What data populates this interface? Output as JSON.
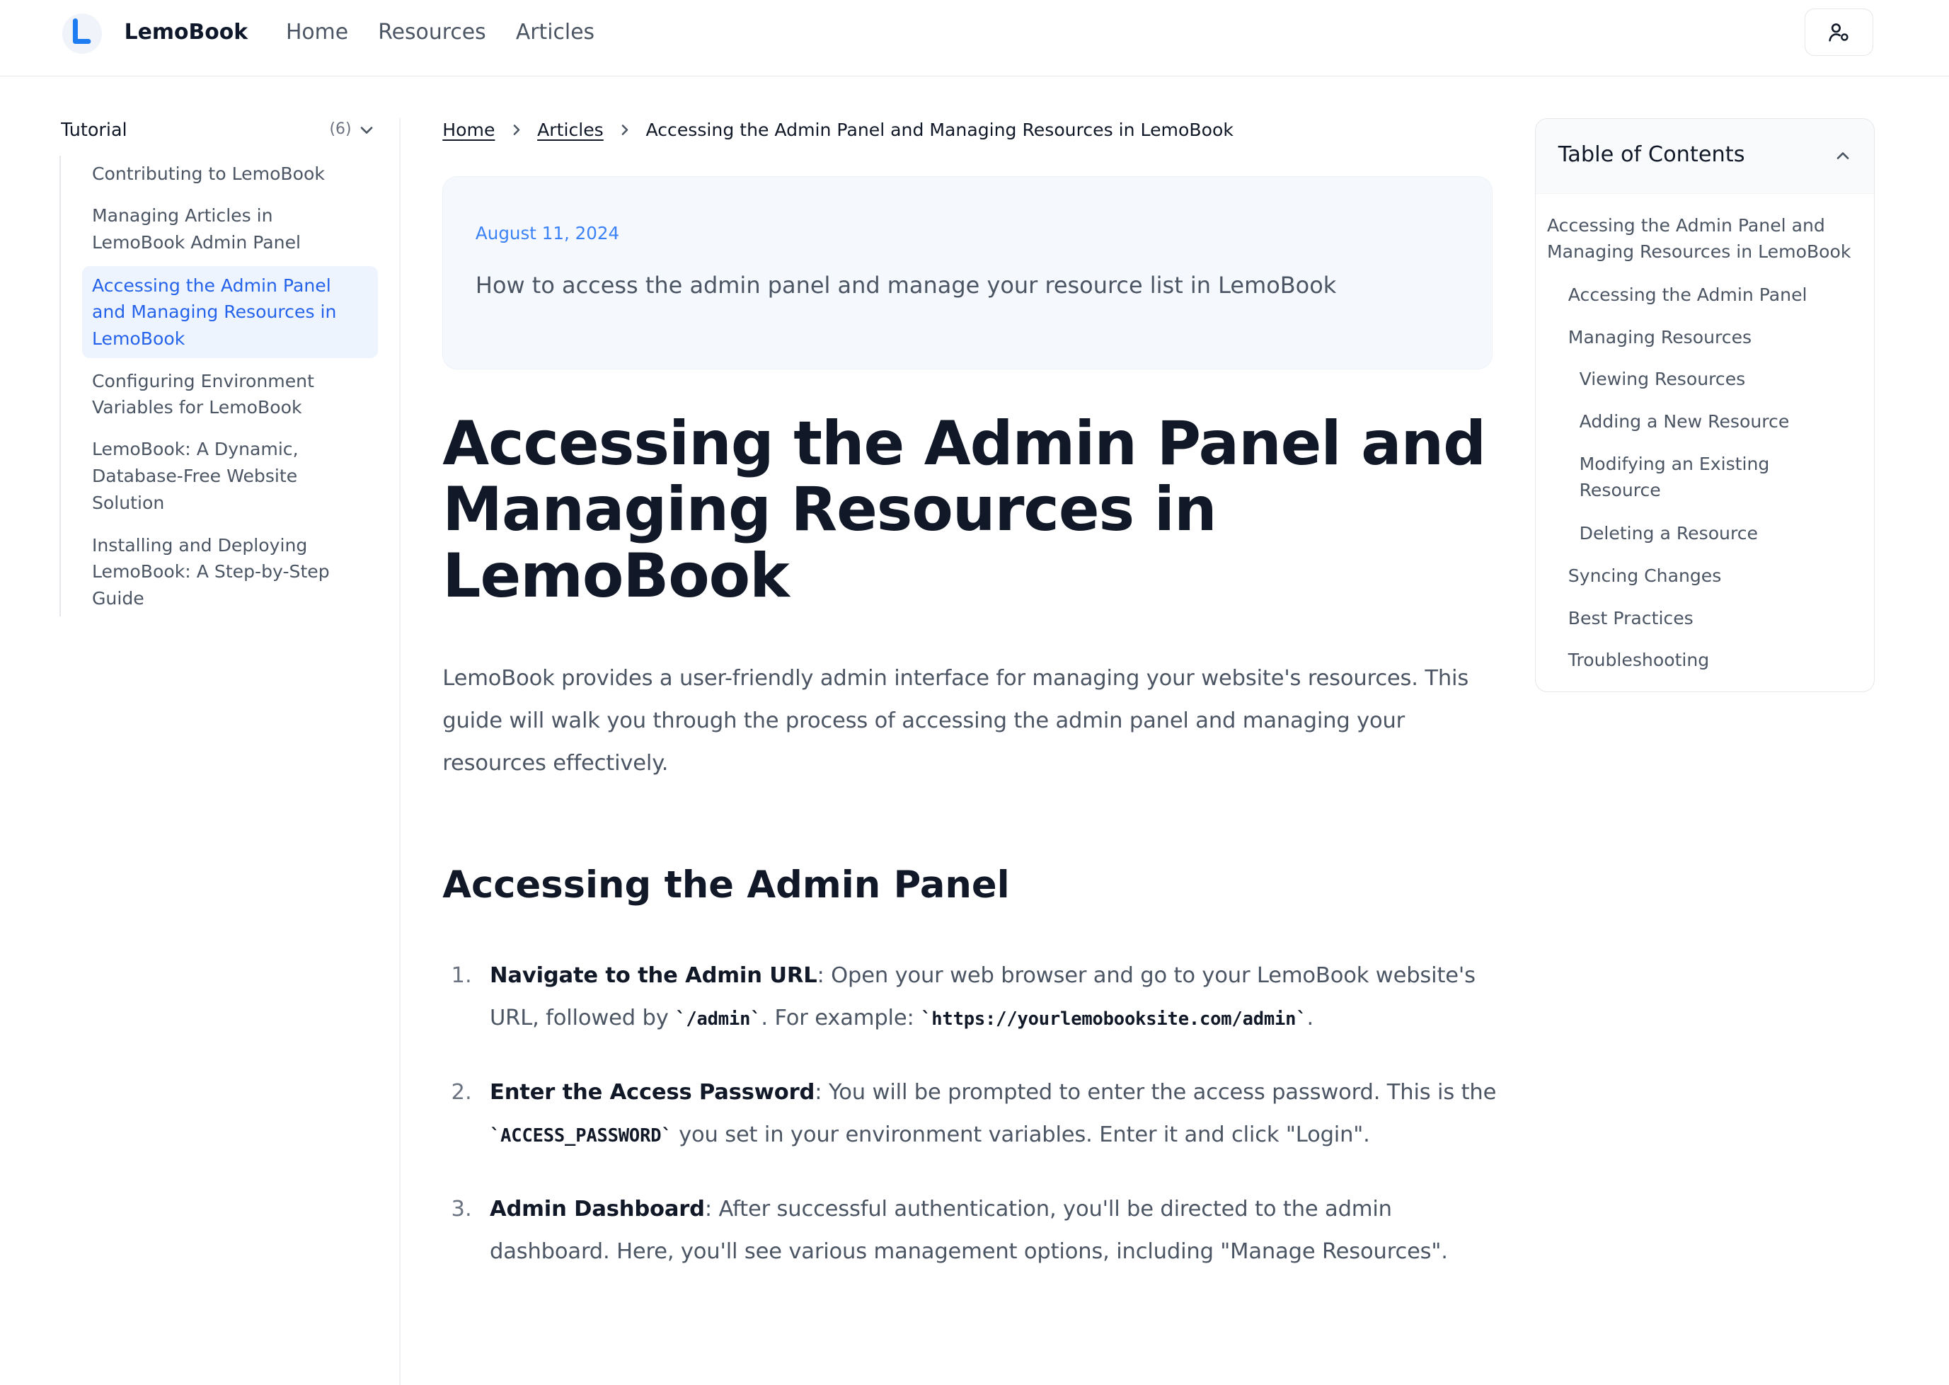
{
  "colors": {
    "accent": "#2563eb",
    "active_bg": "#eef4fe",
    "card_bg": "#f5f8fd"
  },
  "header": {
    "brand": "LemoBook",
    "logo_icon": "lemobook-logo-icon",
    "nav": [
      "Home",
      "Resources",
      "Articles"
    ],
    "user_icon": "user-settings-icon"
  },
  "sidebar": {
    "heading": "Tutorial",
    "count": "(6)",
    "items": [
      {
        "label": "Contributing to LemoBook"
      },
      {
        "label": "Managing Articles in LemoBook Admin Panel"
      },
      {
        "label": "Accessing the Admin Panel and Managing Resources in LemoBook",
        "active": true
      },
      {
        "label": "Configuring Environment Variables for LemoBook"
      },
      {
        "label": "LemoBook: A Dynamic, Database-Free Website Solution"
      },
      {
        "label": "Installing and Deploying LemoBook: A Step-by-Step Guide"
      }
    ]
  },
  "breadcrumb": [
    "Home",
    "Articles",
    "Accessing the Admin Panel and Managing Resources in LemoBook"
  ],
  "article": {
    "date": "August 11, 2024",
    "description": "How to access the admin panel and manage your resource list in LemoBook",
    "title": "Accessing the Admin Panel and Managing Resources in LemoBook",
    "intro": "LemoBook provides a user-friendly admin interface for managing your website's resources. This guide will walk you through the process of accessing the admin panel and managing your resources effectively.",
    "section_heading": "Accessing the Admin Panel",
    "steps": [
      {
        "num": "1.",
        "title": "Navigate to the Admin URL",
        "t1": ": Open your web browser and go to your LemoBook website's URL, followed by ",
        "c1": "`/admin`",
        "t2": ". For example: ",
        "c2": "`https://yourlemobooksite.com/admin`",
        "t3": "."
      },
      {
        "num": "2.",
        "title": "Enter the Access Password",
        "t1": ": You will be prompted to enter the access password. This is the ",
        "c1": "`ACCESS_PASSWORD`",
        "t2": " you set in your environment variables. Enter it and click \"Login\"."
      },
      {
        "num": "3.",
        "title": "Admin Dashboard",
        "t1": ": After successful authentication, you'll be directed to the admin dashboard. Here, you'll see various management options, including \"Manage Resources\"."
      }
    ]
  },
  "toc": {
    "title": "Table of Contents",
    "items": [
      "Accessing the Admin Panel and Managing Resources in LemoBook",
      "Accessing the Admin Panel",
      "Managing Resources",
      "Viewing Resources",
      "Adding a New Resource",
      "Modifying an Existing Resource",
      "Deleting a Resource",
      "Syncing Changes",
      "Best Practices",
      "Troubleshooting"
    ]
  }
}
